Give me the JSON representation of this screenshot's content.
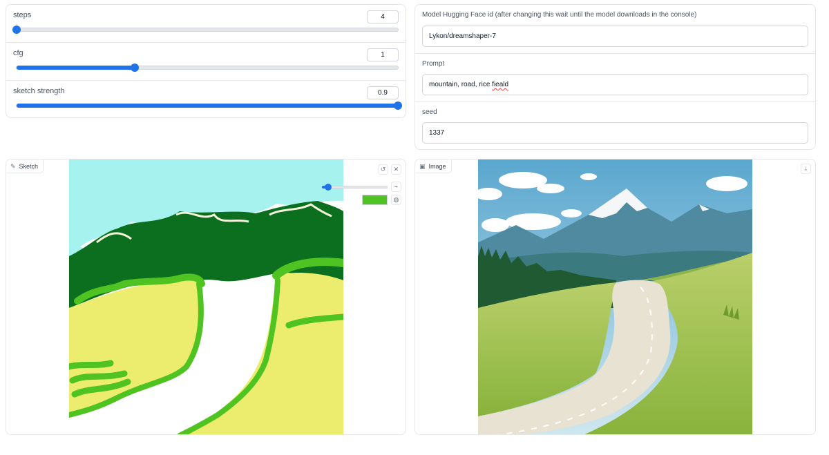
{
  "sliders": [
    {
      "label": "steps",
      "value": "4",
      "fill": 0.0
    },
    {
      "label": "cfg",
      "value": "1",
      "fill": 0.31
    },
    {
      "label": "sketch strength",
      "value": "0.9",
      "fill": 1.0
    }
  ],
  "fields": {
    "model": {
      "label": "Model Hugging Face id (after changing this wait until the model downloads in the console)",
      "value": "Lykon/dreamshaper-7"
    },
    "prompt": {
      "label": "Prompt",
      "value_plain": "mountain, road, rice ",
      "value_misspelled": "fieald"
    },
    "seed": {
      "label": "seed",
      "value": "1337"
    }
  },
  "sketch": {
    "tag_label": "Sketch",
    "brush_size": 0.1,
    "brush_color": "#4fc321",
    "icons": [
      "undo-icon",
      "clear-icon",
      "brush-icon",
      "palette-icon",
      "pencil-icon"
    ]
  },
  "output": {
    "tag_label": "Image",
    "icons": [
      "image-icon",
      "download-icon"
    ]
  },
  "colors": {
    "accent": "#1f72e8",
    "sky_sketch": "#a5f2ef",
    "forest_sketch": "#0b6f1f",
    "field_sketch": "#ecec6e",
    "grass_stroke": "#4fc321"
  }
}
